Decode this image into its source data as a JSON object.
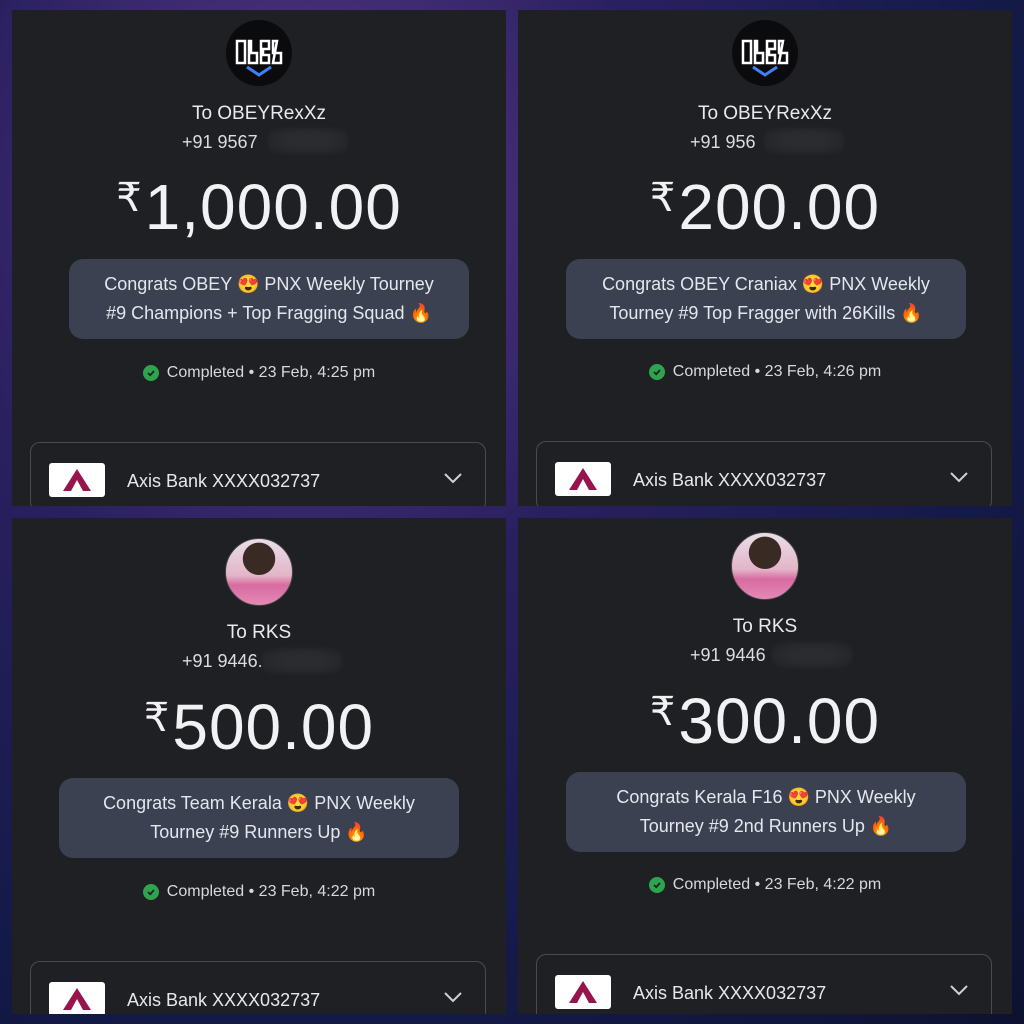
{
  "panels": [
    {
      "recipient": "To OBEYRexXz",
      "phone": "+91 9567",
      "currency": "₹",
      "amount": "1,000.00",
      "note_line1": "Congrats OBEY 😍 PNX Weekly Tourney",
      "note_line2": "#9 Champions + Top Fragging Squad 🔥",
      "status": "Completed • 23 Feb, 4:25 pm",
      "bank": "Axis Bank XXXX032737",
      "avatar_icon": "obey-logo-icon"
    },
    {
      "recipient": "To OBEYRexXz",
      "phone": "+91 956",
      "currency": "₹",
      "amount": "200.00",
      "note_line1": "Congrats OBEY Craniax 😍 PNX Weekly",
      "note_line2": "Tourney #9 Top Fragger with 26Kills 🔥",
      "status": "Completed • 23 Feb, 4:26 pm",
      "bank": "Axis Bank XXXX032737",
      "avatar_icon": "obey-logo-icon"
    },
    {
      "recipient": "To RKS",
      "phone": "+91 9446.",
      "currency": "₹",
      "amount": "500.00",
      "note_line1": "Congrats Team Kerala 😍 PNX Weekly",
      "note_line2": "Tourney #9 Runners Up 🔥",
      "status": "Completed • 23 Feb, 4:22 pm",
      "bank": "Axis Bank XXXX032737",
      "avatar_icon": "profile-photo"
    },
    {
      "recipient": "To RKS",
      "phone": "+91 9446",
      "currency": "₹",
      "amount": "300.00",
      "note_line1": "Congrats Kerala F16 😍 PNX Weekly",
      "note_line2": "Tourney #9 2nd Runners Up 🔥",
      "status": "Completed • 23 Feb, 4:22 pm",
      "bank": "Axis Bank XXXX032737",
      "avatar_icon": "profile-photo"
    }
  ],
  "colors": {
    "panel_bg": "#1f2024",
    "note_bg": "#3b4150",
    "success": "#2fa44f",
    "axis_red": "#97144d"
  }
}
